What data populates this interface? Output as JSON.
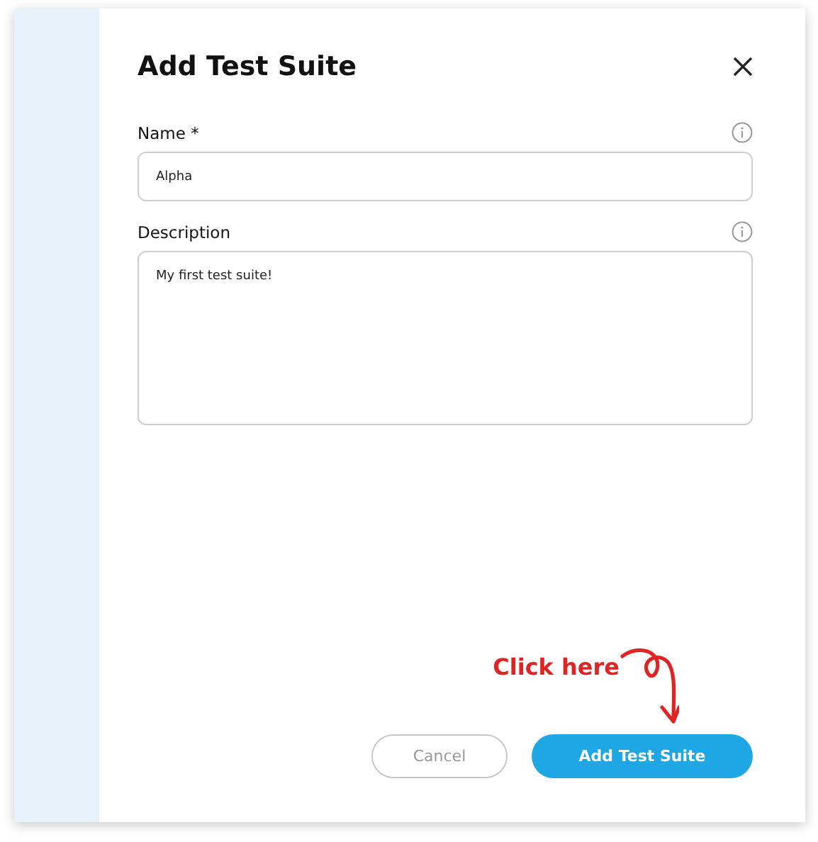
{
  "dialog": {
    "title": "Add Test Suite"
  },
  "fields": [
    {
      "kind": "input",
      "label": "Name *",
      "value": "Alpha"
    },
    {
      "kind": "textarea",
      "label": "Description",
      "value": "My first test suite!"
    }
  ],
  "annotation": {
    "text": "Click here"
  },
  "buttons": [
    {
      "label": "Cancel",
      "kind": "secondary"
    },
    {
      "label": "Add Test Suite",
      "kind": "primary"
    }
  ]
}
